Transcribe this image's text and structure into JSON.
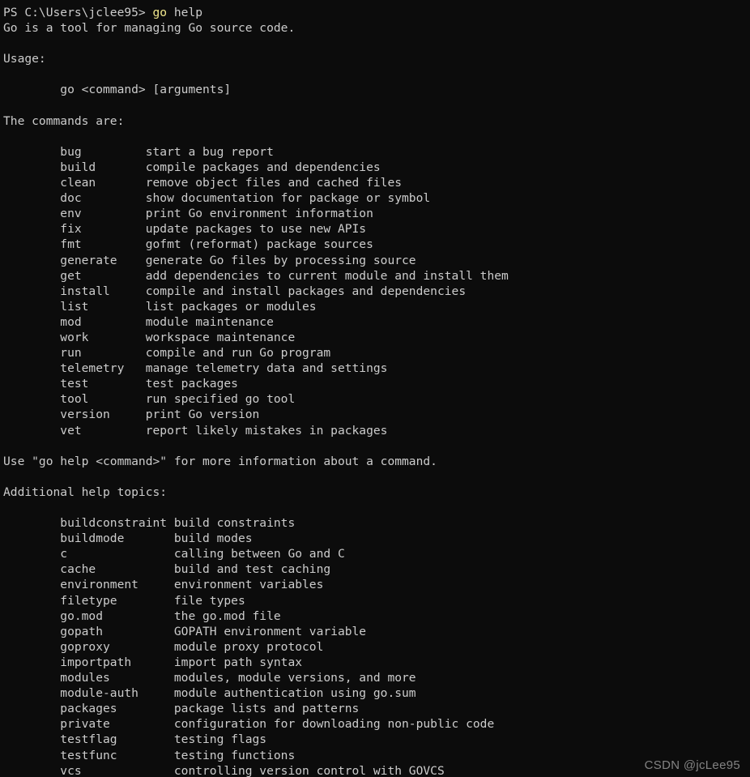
{
  "terminal": {
    "shell": "powershell",
    "background_color": "#0c0c0c",
    "foreground_color": "#cccccc",
    "accent_color": "#f0e68c",
    "prompt": {
      "prefix": "PS C:\\Users\\jclee95> ",
      "command": "go",
      "args": " help"
    },
    "lines": [
      {
        "type": "text",
        "text": "Go is a tool for managing Go source code."
      },
      {
        "type": "blank",
        "text": ""
      },
      {
        "type": "text",
        "text": "Usage:"
      },
      {
        "type": "blank",
        "text": ""
      },
      {
        "type": "text",
        "text": "        go <command> [arguments]"
      },
      {
        "type": "blank",
        "text": ""
      },
      {
        "type": "text",
        "text": "The commands are:"
      },
      {
        "type": "blank",
        "text": ""
      },
      {
        "type": "text",
        "text": "        bug         start a bug report"
      },
      {
        "type": "text",
        "text": "        build       compile packages and dependencies"
      },
      {
        "type": "text",
        "text": "        clean       remove object files and cached files"
      },
      {
        "type": "text",
        "text": "        doc         show documentation for package or symbol"
      },
      {
        "type": "text",
        "text": "        env         print Go environment information"
      },
      {
        "type": "text",
        "text": "        fix         update packages to use new APIs"
      },
      {
        "type": "text",
        "text": "        fmt         gofmt (reformat) package sources"
      },
      {
        "type": "text",
        "text": "        generate    generate Go files by processing source"
      },
      {
        "type": "text",
        "text": "        get         add dependencies to current module and install them"
      },
      {
        "type": "text",
        "text": "        install     compile and install packages and dependencies"
      },
      {
        "type": "text",
        "text": "        list        list packages or modules"
      },
      {
        "type": "text",
        "text": "        mod         module maintenance"
      },
      {
        "type": "text",
        "text": "        work        workspace maintenance"
      },
      {
        "type": "text",
        "text": "        run         compile and run Go program"
      },
      {
        "type": "text",
        "text": "        telemetry   manage telemetry data and settings"
      },
      {
        "type": "text",
        "text": "        test        test packages"
      },
      {
        "type": "text",
        "text": "        tool        run specified go tool"
      },
      {
        "type": "text",
        "text": "        version     print Go version"
      },
      {
        "type": "text",
        "text": "        vet         report likely mistakes in packages"
      },
      {
        "type": "blank",
        "text": ""
      },
      {
        "type": "text",
        "text": "Use \"go help <command>\" for more information about a command."
      },
      {
        "type": "blank",
        "text": ""
      },
      {
        "type": "text",
        "text": "Additional help topics:"
      },
      {
        "type": "blank",
        "text": ""
      },
      {
        "type": "text",
        "text": "        buildconstraint build constraints"
      },
      {
        "type": "text",
        "text": "        buildmode       build modes"
      },
      {
        "type": "text",
        "text": "        c               calling between Go and C"
      },
      {
        "type": "text",
        "text": "        cache           build and test caching"
      },
      {
        "type": "text",
        "text": "        environment     environment variables"
      },
      {
        "type": "text",
        "text": "        filetype        file types"
      },
      {
        "type": "text",
        "text": "        go.mod          the go.mod file"
      },
      {
        "type": "text",
        "text": "        gopath          GOPATH environment variable"
      },
      {
        "type": "text",
        "text": "        goproxy         module proxy protocol"
      },
      {
        "type": "text",
        "text": "        importpath      import path syntax"
      },
      {
        "type": "text",
        "text": "        modules         modules, module versions, and more"
      },
      {
        "type": "text",
        "text": "        module-auth     module authentication using go.sum"
      },
      {
        "type": "text",
        "text": "        packages        package lists and patterns"
      },
      {
        "type": "text",
        "text": "        private         configuration for downloading non-public code"
      },
      {
        "type": "text",
        "text": "        testflag        testing flags"
      },
      {
        "type": "text",
        "text": "        testfunc        testing functions"
      },
      {
        "type": "text",
        "text": "        vcs             controlling version control with GOVCS"
      }
    ],
    "commands": [
      {
        "name": "bug",
        "description": "start a bug report"
      },
      {
        "name": "build",
        "description": "compile packages and dependencies"
      },
      {
        "name": "clean",
        "description": "remove object files and cached files"
      },
      {
        "name": "doc",
        "description": "show documentation for package or symbol"
      },
      {
        "name": "env",
        "description": "print Go environment information"
      },
      {
        "name": "fix",
        "description": "update packages to use new APIs"
      },
      {
        "name": "fmt",
        "description": "gofmt (reformat) package sources"
      },
      {
        "name": "generate",
        "description": "generate Go files by processing source"
      },
      {
        "name": "get",
        "description": "add dependencies to current module and install them"
      },
      {
        "name": "install",
        "description": "compile and install packages and dependencies"
      },
      {
        "name": "list",
        "description": "list packages or modules"
      },
      {
        "name": "mod",
        "description": "module maintenance"
      },
      {
        "name": "work",
        "description": "workspace maintenance"
      },
      {
        "name": "run",
        "description": "compile and run Go program"
      },
      {
        "name": "telemetry",
        "description": "manage telemetry data and settings"
      },
      {
        "name": "test",
        "description": "test packages"
      },
      {
        "name": "tool",
        "description": "run specified go tool"
      },
      {
        "name": "version",
        "description": "print Go version"
      },
      {
        "name": "vet",
        "description": "report likely mistakes in packages"
      }
    ],
    "help_topics": [
      {
        "name": "buildconstraint",
        "description": "build constraints"
      },
      {
        "name": "buildmode",
        "description": "build modes"
      },
      {
        "name": "c",
        "description": "calling between Go and C"
      },
      {
        "name": "cache",
        "description": "build and test caching"
      },
      {
        "name": "environment",
        "description": "environment variables"
      },
      {
        "name": "filetype",
        "description": "file types"
      },
      {
        "name": "go.mod",
        "description": "the go.mod file"
      },
      {
        "name": "gopath",
        "description": "GOPATH environment variable"
      },
      {
        "name": "goproxy",
        "description": "module proxy protocol"
      },
      {
        "name": "importpath",
        "description": "import path syntax"
      },
      {
        "name": "modules",
        "description": "modules, module versions, and more"
      },
      {
        "name": "module-auth",
        "description": "module authentication using go.sum"
      },
      {
        "name": "packages",
        "description": "package lists and patterns"
      },
      {
        "name": "private",
        "description": "configuration for downloading non-public code"
      },
      {
        "name": "testflag",
        "description": "testing flags"
      },
      {
        "name": "testfunc",
        "description": "testing functions"
      },
      {
        "name": "vcs",
        "description": "controlling version control with GOVCS"
      }
    ]
  },
  "watermark": {
    "text": "CSDN @jcLee95"
  }
}
